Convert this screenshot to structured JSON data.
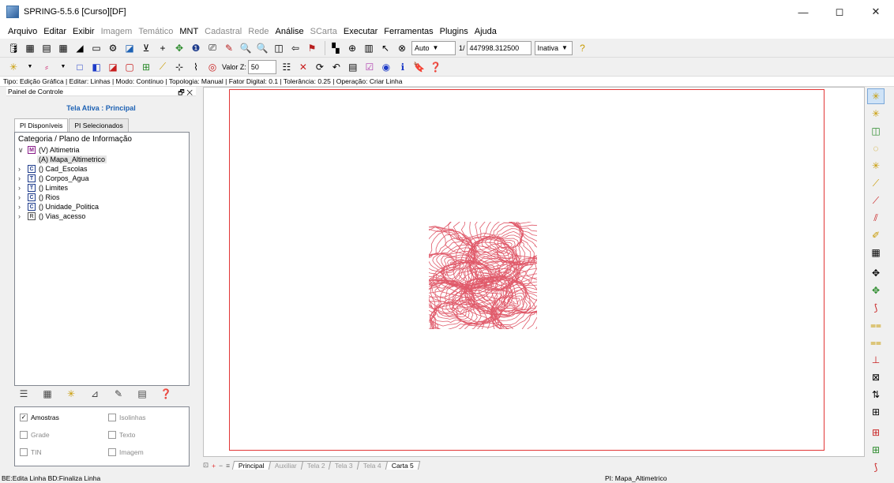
{
  "window": {
    "title": "SPRING-5.5.6 [Curso][DF]",
    "controls": [
      "—",
      "◻",
      "✕"
    ]
  },
  "menu": [
    {
      "label": "Arquivo",
      "enabled": true
    },
    {
      "label": "Editar",
      "enabled": true
    },
    {
      "label": "Exibir",
      "enabled": true
    },
    {
      "label": "Imagem",
      "enabled": false
    },
    {
      "label": "Temático",
      "enabled": false
    },
    {
      "label": "MNT",
      "enabled": true
    },
    {
      "label": "Cadastral",
      "enabled": false
    },
    {
      "label": "Rede",
      "enabled": false
    },
    {
      "label": "Análise",
      "enabled": true
    },
    {
      "label": "SCarta",
      "enabled": false
    },
    {
      "label": "Executar",
      "enabled": true
    },
    {
      "label": "Ferramentas",
      "enabled": true
    },
    {
      "label": "Plugins",
      "enabled": true
    },
    {
      "label": "Ajuda",
      "enabled": true
    }
  ],
  "toolbar1": {
    "auto_combo": "Auto",
    "scale_prefix": "1/",
    "scale_value": "447998.312500",
    "state_combo": "Inativa"
  },
  "toolbar2": {
    "valor_z_label": "Valor Z:",
    "valor_z_value": "50"
  },
  "edit_status": "Tipo: Edição Gráfica | Editar: Linhas | Modo: Contínuo | Topologia: Manual | Fator Digital: 0.1 | Tolerância: 0.25 | Operação: Criar Linha",
  "control_panel": {
    "title": "Painel de Controle",
    "active_screen": "Tela Ativa : Principal",
    "tabs": [
      "PI Disponíveis",
      "PI Selecionados"
    ],
    "tree_header": "Categoria / Plano de Informação",
    "categories": [
      {
        "badge": "M",
        "label": "(V) Altimetria",
        "expanded": true,
        "children": [
          "(A) Mapa_Altimetrico"
        ]
      },
      {
        "badge": "C",
        "label": "() Cad_Escolas",
        "expanded": false
      },
      {
        "badge": "T",
        "label": "() Corpos_Agua",
        "expanded": false
      },
      {
        "badge": "T",
        "label": "() Limites",
        "expanded": false
      },
      {
        "badge": "C",
        "label": "() Rios",
        "expanded": false
      },
      {
        "badge": "C",
        "label": "() Unidade_Politica",
        "expanded": false
      },
      {
        "badge": "R",
        "label": "() Vias_acesso",
        "expanded": false
      }
    ],
    "checkboxes": [
      {
        "label": "Amostras",
        "checked": true,
        "enabled": true
      },
      {
        "label": "Isolinhas",
        "checked": false,
        "enabled": false
      },
      {
        "label": "Grade",
        "checked": false,
        "enabled": false
      },
      {
        "label": "Texto",
        "checked": false,
        "enabled": false
      },
      {
        "label": "TIN",
        "checked": false,
        "enabled": false
      },
      {
        "label": "Imagem",
        "checked": false,
        "enabled": false
      }
    ]
  },
  "canvas": {
    "frame_color": "#e23636",
    "contour_color": "#e05a6a"
  },
  "screen_tabs": [
    {
      "label": "Principal",
      "state": "selected"
    },
    {
      "label": "Auxiliar",
      "state": "disabled"
    },
    {
      "label": "Tela 2",
      "state": "disabled"
    },
    {
      "label": "Tela 3",
      "state": "disabled"
    },
    {
      "label": "Tela 4",
      "state": "disabled"
    },
    {
      "label": "Carta 5",
      "state": "active"
    }
  ],
  "statusbar": {
    "left": "BE:Edita Linha  BD:Finaliza Linha",
    "pi": "PI: Mapa_Altimetrico"
  }
}
